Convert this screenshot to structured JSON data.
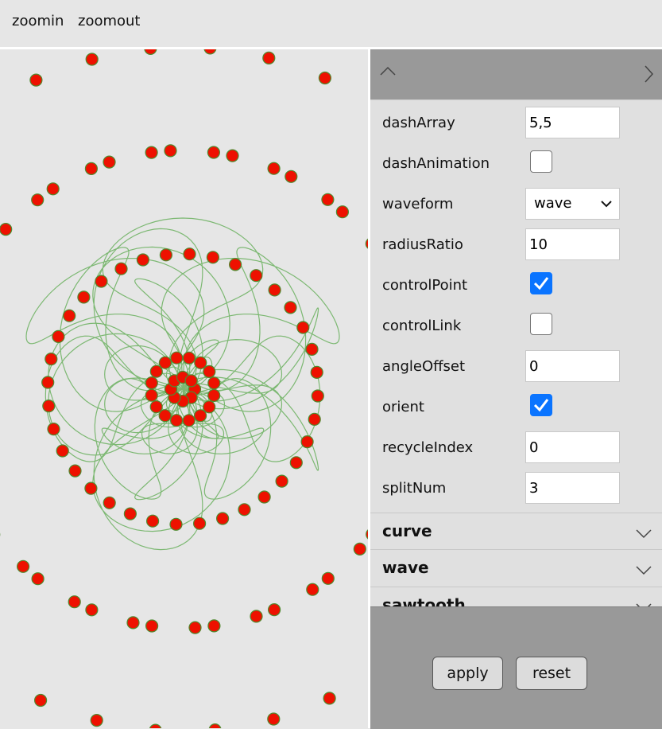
{
  "toolbar": {
    "zoomin": "zoomin",
    "zoomout": "zoomout"
  },
  "panel": {
    "rows": [
      {
        "label": "dashArray",
        "type": "text",
        "value": "5,5"
      },
      {
        "label": "dashAnimation",
        "type": "checkbox",
        "checked": false
      },
      {
        "label": "waveform",
        "type": "select",
        "value": "wave"
      },
      {
        "label": "radiusRatio",
        "type": "text",
        "value": "10"
      },
      {
        "label": "controlPoint",
        "type": "checkbox",
        "checked": true
      },
      {
        "label": "controlLink",
        "type": "checkbox",
        "checked": false
      },
      {
        "label": "angleOffset",
        "type": "text",
        "value": "0"
      },
      {
        "label": "orient",
        "type": "checkbox",
        "checked": true
      },
      {
        "label": "recycleIndex",
        "type": "text",
        "value": "0"
      },
      {
        "label": "splitNum",
        "type": "text",
        "value": "3"
      }
    ],
    "sections": [
      "curve",
      "wave",
      "sawtooth"
    ],
    "buttons": {
      "apply": "apply",
      "reset": "reset"
    }
  },
  "colors": {
    "curve": "#7cb872",
    "point_fill": "#ee1100",
    "point_stroke": "#4f8a2f",
    "checkbox_on": "#0a74ff",
    "panel_dark": "#999999"
  }
}
